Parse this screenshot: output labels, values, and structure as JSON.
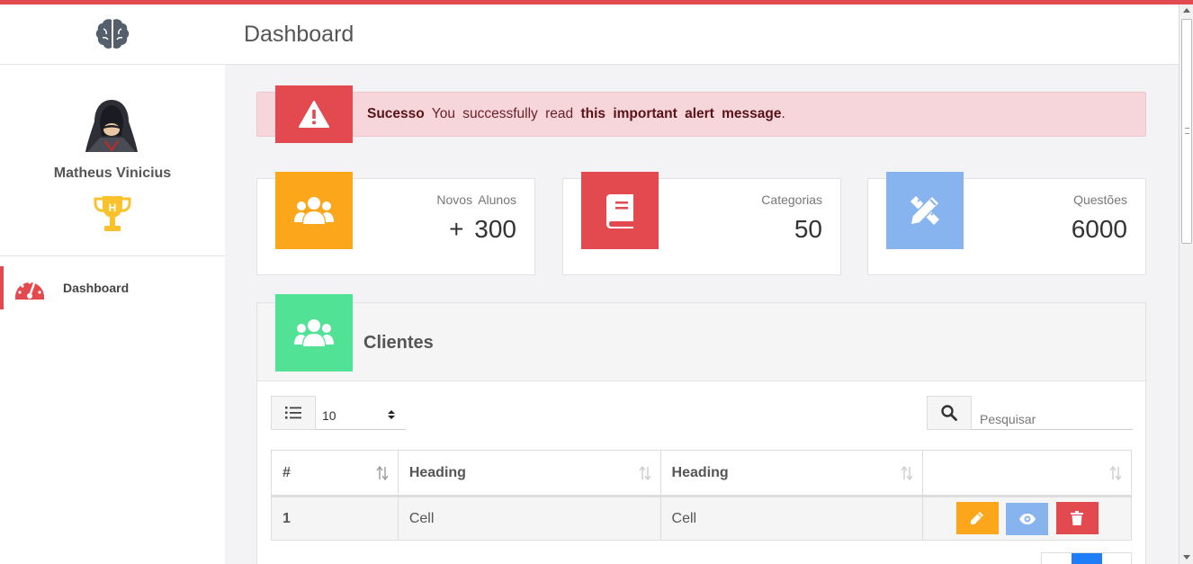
{
  "header": {
    "title": "Dashboard",
    "logo_icon": "brain-icon"
  },
  "sidebar": {
    "user_name": "Matheus Vinicius",
    "badge_letter": "H",
    "items": [
      {
        "label": "Dashboard",
        "icon": "speedometer-icon",
        "active": true
      }
    ]
  },
  "alert": {
    "strong": "Sucesso",
    "text": " You successfully read ",
    "bold": "this important alert message",
    "end": ".",
    "icon": "warning-icon",
    "color": "#e34a4f"
  },
  "stats": [
    {
      "label": "Novos Alunos",
      "value": "+ 300",
      "icon": "users-icon",
      "color": "#fba61b"
    },
    {
      "label": "Categorias",
      "value": "50",
      "icon": "book-icon",
      "color": "#e34a4f"
    },
    {
      "label": "Questões",
      "value": "6000",
      "icon": "pencil-ruler-icon",
      "color": "#87b3ef"
    }
  ],
  "clients": {
    "title": "Clientes",
    "icon": "users-icon",
    "color": "#52e296",
    "page_length": "10",
    "search_placeholder": "Pesquisar",
    "columns": [
      "#",
      "Heading",
      "Heading",
      ""
    ],
    "rows": [
      {
        "num": "1",
        "c1": "Cell",
        "c2": "Cell"
      }
    ],
    "actions": {
      "edit_color": "#fba61b",
      "view_color": "#87b3ef",
      "delete_color": "#e34a4f"
    }
  }
}
